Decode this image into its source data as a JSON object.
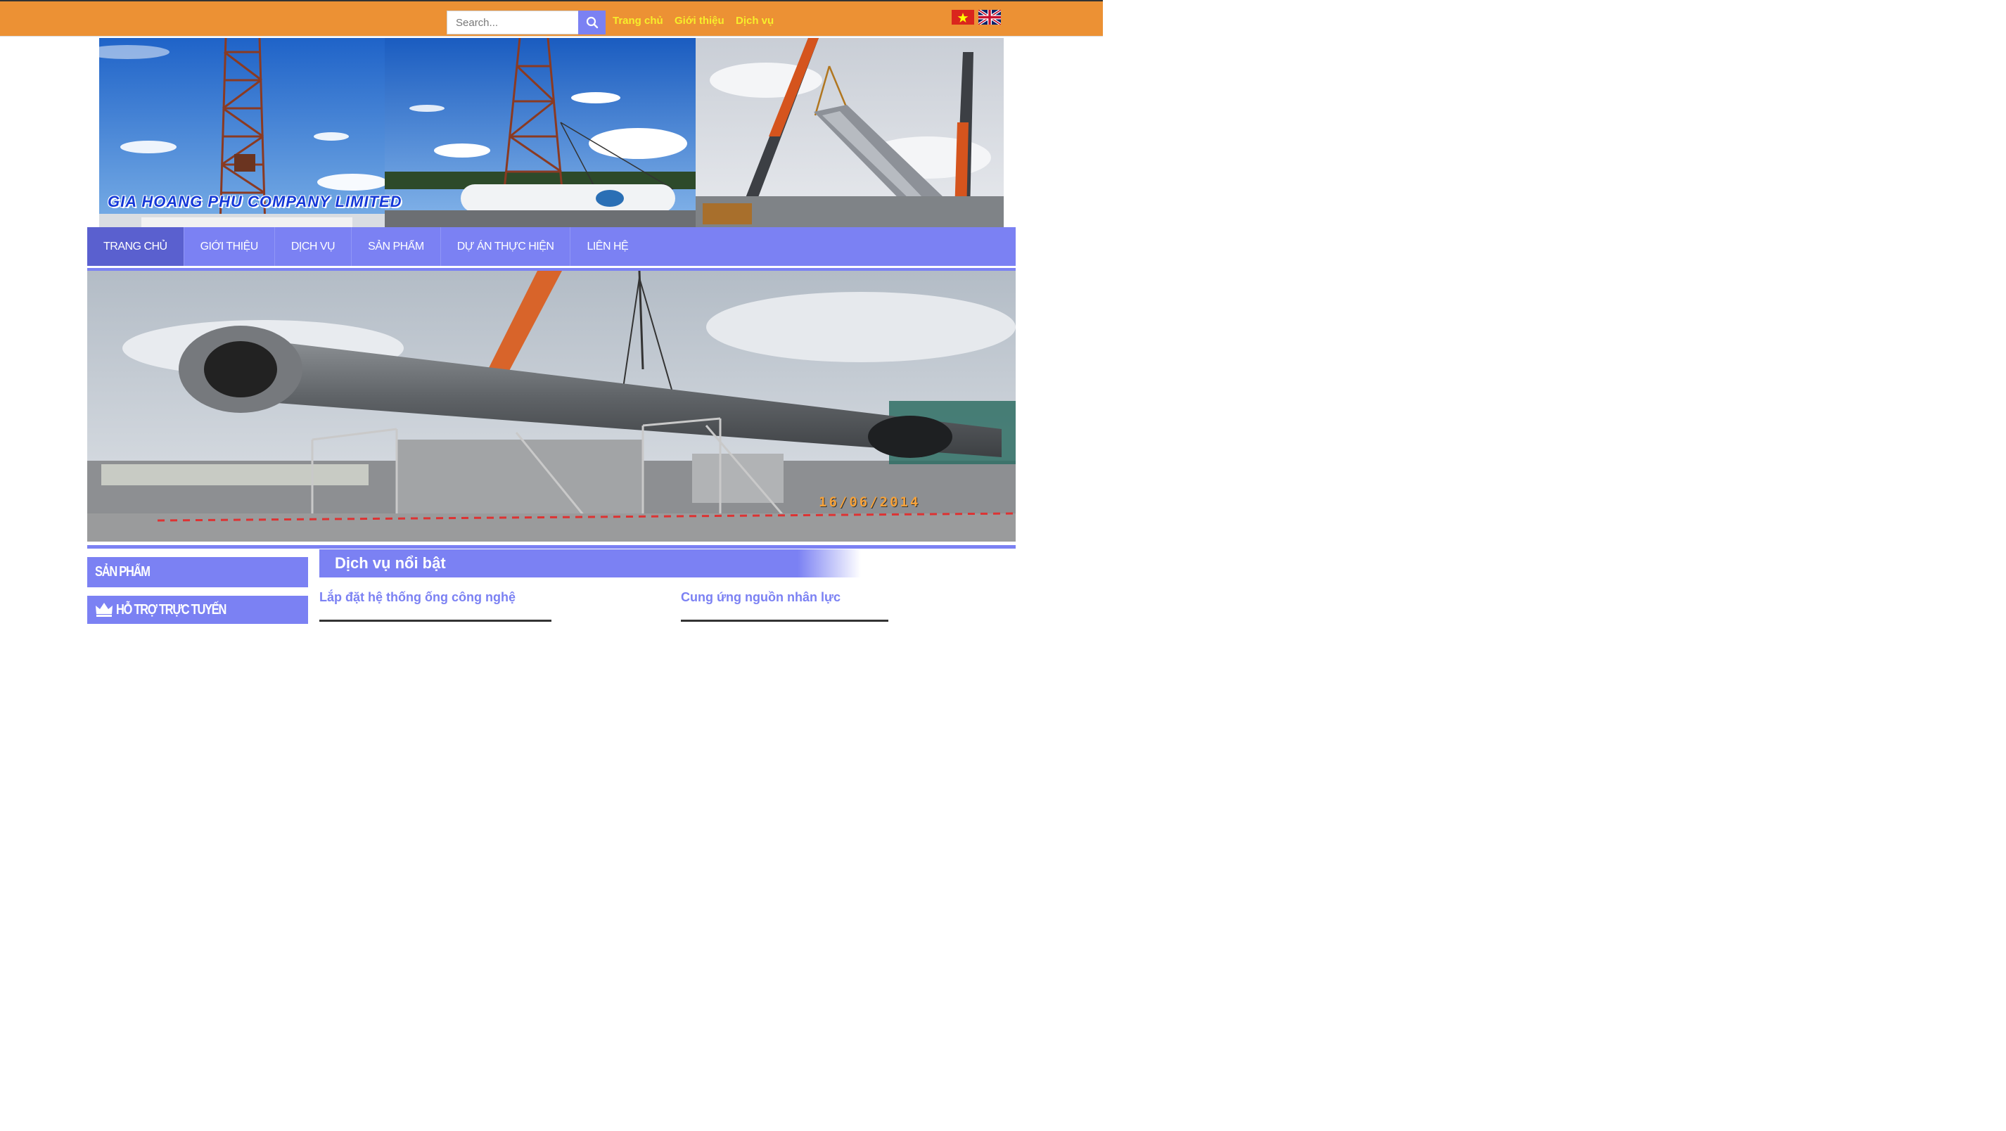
{
  "topbar": {
    "search": {
      "placeholder": "Search..."
    },
    "links": [
      "Trang chủ",
      "Giới thiệu",
      "Dịch vụ"
    ],
    "languages": [
      "Vietnamese",
      "English"
    ],
    "background_color": "#ec9134",
    "link_color": "#f7ee2b"
  },
  "banner": {
    "company_name": "GIA HOANG PHU COMPANY LIMITED",
    "company_name_color": "#1438d8"
  },
  "nav": {
    "items": [
      "TRANG CHỦ",
      "GIỚI THIỆU",
      "DỊCH VỤ",
      "SẢN PHẨM",
      "DỰ ÁN THỰC HIỆN",
      "LIÊN HỆ"
    ],
    "active_index": 0,
    "accent_color": "#7b81f3"
  },
  "hero": {
    "date_stamp": "16/06/2014"
  },
  "sidebar": {
    "products_title": "SẢN PHẨM",
    "support_title": "HỖ TRỢ TRỰC TUYẾN",
    "support_icon": "crown-icon"
  },
  "featured": {
    "title": "Dịch vụ nổi bật",
    "services": [
      "Lắp đặt hệ thống ống công nghệ",
      "Cung ứng nguồn nhân lực"
    ]
  }
}
